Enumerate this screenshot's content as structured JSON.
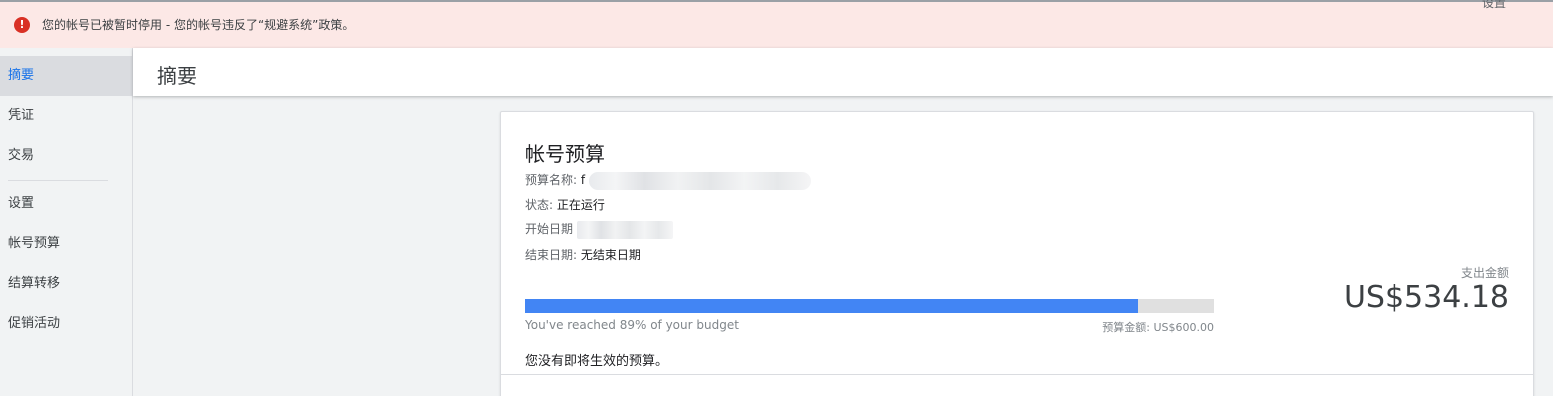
{
  "alert": {
    "message": "您的帐号已被暂时停用 - 您的帐号违反了“规避系统”政策。",
    "settings_link": "设置"
  },
  "sidebar": {
    "items": [
      {
        "label": "摘要",
        "active": true
      },
      {
        "label": "凭证"
      },
      {
        "label": "交易"
      },
      {
        "label": "设置"
      },
      {
        "label": "帐号预算"
      },
      {
        "label": "结算转移"
      },
      {
        "label": "促销活动"
      }
    ]
  },
  "header": {
    "title": "摘要"
  },
  "budget_card": {
    "title": "帐号预算",
    "name_label": "预算名称:",
    "name_value": "f",
    "status_label": "状态:",
    "status_value": "正在运行",
    "start_label": "开始日期",
    "end_label": "结束日期:",
    "end_value": "无结束日期",
    "progress_fraction": 0.89,
    "progress_caption": "You've reached 89% of your budget",
    "budget_amount": "预算金额: US$600.00",
    "spend_label": "支出金额",
    "spend_value": "US$534.18",
    "no_pending": "您没有即将生效的预算。"
  },
  "colors": {
    "alert_bg": "#fce8e6",
    "error_icon": "#d93025",
    "accent": "#1a73e8",
    "progress_fill": "#4285f4",
    "progress_track": "#e0e0e0"
  },
  "icons": {
    "alert": "error-icon"
  }
}
